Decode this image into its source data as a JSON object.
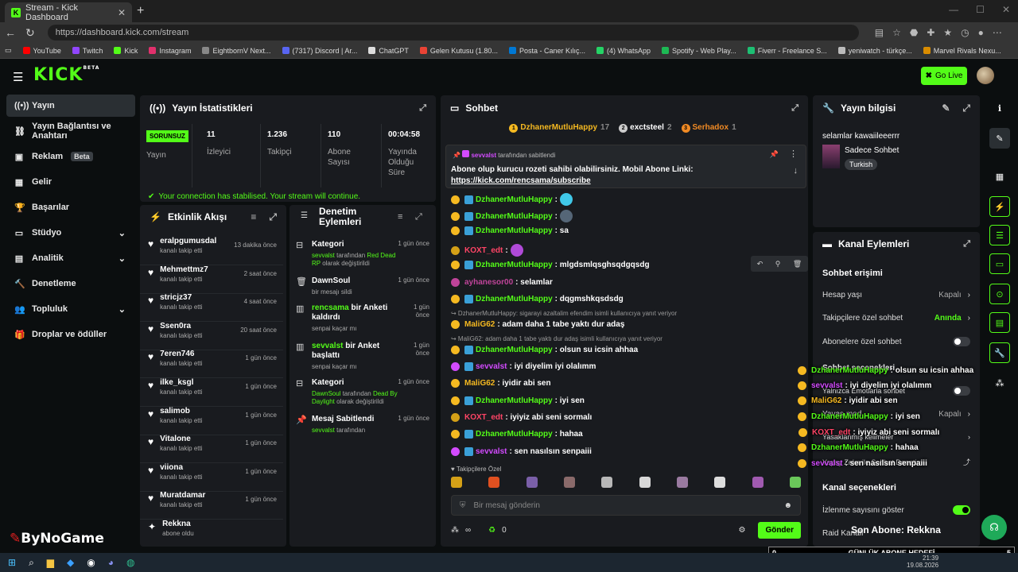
{
  "browser": {
    "tab_title": "Stream - Kick Dashboard",
    "url": "https://dashboard.kick.com/stream",
    "bookmarks": [
      {
        "label": "YouTube",
        "color": "#ff0000"
      },
      {
        "label": "Twitch",
        "color": "#9146ff"
      },
      {
        "label": "Kick",
        "color": "#53fc18"
      },
      {
        "label": "Instagram",
        "color": "#e1306c"
      },
      {
        "label": "EightbornV Next...",
        "color": "#888888"
      },
      {
        "label": "(7317) Discord | Ar...",
        "color": "#5865f2"
      },
      {
        "label": "ChatGPT",
        "color": "#dddddd"
      },
      {
        "label": "Gelen Kutusu (1.80...",
        "color": "#ea4335"
      },
      {
        "label": "Posta - Caner Kılıç...",
        "color": "#0078d4"
      },
      {
        "label": "(4) WhatsApp",
        "color": "#25d366"
      },
      {
        "label": "Spotify - Web Play...",
        "color": "#1db954"
      },
      {
        "label": "Fiverr - Freelance S...",
        "color": "#1dbf73"
      },
      {
        "label": "yeniwatch - türkçe...",
        "color": "#bbbbbb"
      },
      {
        "label": "Marvel Rivals Nexu...",
        "color": "#d98c00"
      }
    ]
  },
  "header": {
    "logo": "KICK",
    "logo_sup": "BETA",
    "go_live": "Go Live"
  },
  "sidebar": {
    "items": [
      {
        "label": "Yayın",
        "icon": "broadcast-icon",
        "active": true
      },
      {
        "label": "Yayın Bağlantısı ve Anahtarı",
        "icon": "link-icon"
      },
      {
        "label": "Reklam",
        "icon": "ad-icon",
        "badge": "Beta"
      },
      {
        "label": "Gelir",
        "icon": "revenue-icon"
      },
      {
        "label": "Başarılar",
        "icon": "trophy-icon"
      },
      {
        "label": "Stüdyo",
        "icon": "studio-icon",
        "chevron": true
      },
      {
        "label": "Analitik",
        "icon": "chart-icon",
        "chevron": true
      },
      {
        "label": "Denetleme",
        "icon": "hammer-icon"
      },
      {
        "label": "Topluluk",
        "icon": "community-icon",
        "chevron": true
      },
      {
        "label": "Droplar ve ödüller",
        "icon": "gift-icon"
      }
    ],
    "watermark": "ByNoGame"
  },
  "stats": {
    "title": "Yayın İstatistikleri",
    "status_badge": "SORUNSUZ",
    "status_label": "Yayın",
    "cells": [
      {
        "value": "11",
        "label": "İzleyici"
      },
      {
        "value": "1.236",
        "label": "Takipçi"
      },
      {
        "value": "110",
        "label": "Abone Sayısı"
      },
      {
        "value": "00:04:58",
        "label": "Yayında Olduğu Süre"
      }
    ],
    "connection": "Your connection has stabilised. Your stream will continue."
  },
  "activity": {
    "title": "Etkinlik Akışı",
    "rows": [
      {
        "name": "eralpgumusdal",
        "sub": "kanalı takip etti",
        "time": "13 dakika önce"
      },
      {
        "name": "Mehmettmz7",
        "sub": "kanalı takip etti",
        "time": "2 saat önce"
      },
      {
        "name": "stricjz37",
        "sub": "kanalı takip etti",
        "time": "4 saat önce"
      },
      {
        "name": "Ssen0ra",
        "sub": "kanalı takip etti",
        "time": "20 saat önce"
      },
      {
        "name": "7eren746",
        "sub": "kanalı takip etti",
        "time": "1 gün önce"
      },
      {
        "name": "ilke_ksgl",
        "sub": "kanalı takip etti",
        "time": "1 gün önce"
      },
      {
        "name": "salimob",
        "sub": "kanalı takip etti",
        "time": "1 gün önce"
      },
      {
        "name": "Vitalone",
        "sub": "kanalı takip etti",
        "time": "1 gün önce"
      },
      {
        "name": "viiona",
        "sub": "kanalı takip etti",
        "time": "1 gün önce"
      },
      {
        "name": "Muratdamar",
        "sub": "kanalı takip etti",
        "time": "1 gün önce"
      },
      {
        "name": "Rekkna",
        "sub": "abone oldu",
        "time": ""
      }
    ]
  },
  "moderation": {
    "title1": "Denetim",
    "title2": "Eylemleri",
    "rows": [
      {
        "title": "Kategori",
        "time": "1 gün önce",
        "sub_a": "sevvalst",
        "sub_b": " tarafından ",
        "sub_c": "Red Dead RP",
        "sub_d": " olarak değiştirildi"
      },
      {
        "title": "DawnSoul",
        "time": "1 gün önce",
        "sub": "bir mesajı sildi"
      },
      {
        "title_a": "rencsama",
        "title_b": " bir Anketi kaldırdı",
        "time1": "1 gün",
        "time2": "önce",
        "sub": "senpai kaçar mı"
      },
      {
        "title_a": "sevvalst",
        "title_b": " bir Anket başlattı",
        "time1": "1 gün",
        "time2": "önce",
        "sub": "senpai kaçar mı"
      },
      {
        "title": "Kategori",
        "time": "1 gün önce",
        "sub_a": "DawnSoul",
        "sub_b": " tarafından ",
        "sub_c": "Dead By Daylight",
        "sub_d": " olarak değiştirildi"
      },
      {
        "title": "Mesaj Sabitlendi",
        "time": "1 gün önce",
        "sub_a": "sevvalst",
        "sub_b": " tarafından"
      }
    ]
  },
  "chat": {
    "title": "Sohbet",
    "top": [
      {
        "name": "DzhanerMutluHappy",
        "count": "17"
      },
      {
        "name": "exctsteel",
        "count": "2"
      },
      {
        "name": "Serhadox",
        "count": "1"
      }
    ],
    "pinned_by": "sevvalst",
    "pinned_suffix": "tarafından sabitlendi",
    "pinned_text": "Abone olup kurucu rozeti sahibi olabilirsiniz. Mobil Abone Linki:",
    "pinned_link": "https://kick.com/rencsama/subscribe",
    "messages": [
      {
        "user": "DzhanerMutluHappy",
        "color": "#53fc18",
        "text": ":",
        "emote": "#40c8e8"
      },
      {
        "user": "DzhanerMutluHappy",
        "color": "#53fc18",
        "text": ":",
        "emote": "#556677"
      },
      {
        "user": "DzhanerMutluHappy",
        "color": "#53fc18",
        "text": ": sa"
      },
      {
        "user": "KOXT_edt",
        "color": "#ff4466",
        "text": ":",
        "emote": "#b04ad8"
      },
      {
        "user": "DzhanerMutluHappy",
        "color": "#53fc18",
        "text": ": mlgdsmlqsghsqdgqsdg"
      },
      {
        "user": "ayhanesor00",
        "color": "#c0449a",
        "text": ": selamlar"
      },
      {
        "user": "DzhanerMutluHappy",
        "color": "#53fc18",
        "text": ": dqgmshkqsdsdg"
      },
      {
        "user": "MaliG62",
        "color": "#f5b921",
        "text": ": adam daha 1 tabe yaktı dur adaş"
      },
      {
        "user": "DzhanerMutluHappy",
        "color": "#53fc18",
        "text": ": olsun su icsin ahhaa"
      },
      {
        "user": "sevvalst",
        "color": "#d34bff",
        "text": ": iyi diyelim iyi olalımm"
      },
      {
        "user": "MaliG62",
        "color": "#f5b921",
        "text": ": iyidir abi sen"
      },
      {
        "user": "DzhanerMutluHappy",
        "color": "#53fc18",
        "text": ": iyi sen"
      },
      {
        "user": "KOXT_edt",
        "color": "#ff4466",
        "text": ": iyiyiz abi seni sormalı"
      },
      {
        "user": "DzhanerMutluHappy",
        "color": "#53fc18",
        "text": ": hahaa"
      },
      {
        "user": "sevvalst",
        "color": "#d34bff",
        "text": ": sen nasılsın senpaiii"
      }
    ],
    "reply1": "↪ DzhanerMutluHappy: sigarayi azaltalim efendim isimli kullanıcıya yanıt veriyor",
    "reply2": "↪ MaliG62: adam daha 1 tabe yaktı dur adaş isimli kullanıcıya yanıt veriyor",
    "followers_only_label": "Takipçilere Özel",
    "input_placeholder": "Bir mesaj gönderin",
    "infinity": "∞",
    "points": "0",
    "send": "Gönder"
  },
  "stream_info": {
    "title": "Yayın bilgisi",
    "stream_title": "selamlar kawaiileeerrr",
    "category": "Sadece Sohbet",
    "tag": "Turkish"
  },
  "channel_actions": {
    "title": "Kanal Eylemleri",
    "chat_access": "Sohbet erişimi",
    "rows": [
      {
        "label": "Hesap yaşı",
        "value": "Kapalı"
      },
      {
        "label": "Takipçilere özel sohbet",
        "value": "Anında"
      },
      {
        "label": "Abonelere özel sohbet",
        "toggle": false
      },
      {
        "label": "Sohbet seçenekleri"
      },
      {
        "label": "Yalnızca Emotlarla sohbet",
        "toggle": false
      },
      {
        "label": "Yavaş mod",
        "value": "Kapalı"
      },
      {
        "label": "Yasaklanmış kelimeler"
      },
      {
        "label": "Yapay Zeka ile Sohbet Denetimi"
      }
    ],
    "channel_options": "Kanal seçenekleri",
    "show_views": "İzlenme sayısını göster",
    "raid": "Raid Kanalı"
  },
  "overlay": {
    "chat": [
      {
        "user": "DzhanerMutluHappy",
        "text": ": olsun su icsin ahhaa",
        "color": "#53fc18"
      },
      {
        "user": "sevvalst",
        "text": ": iyi diyelim iyi olalımm",
        "color": "#d34bff"
      },
      {
        "user": "MaliG62",
        "text": ": iyidir abi sen",
        "color": "#f5b921"
      },
      {
        "user": "DzhanerMutluHappy",
        "text": ": iyi sen",
        "color": "#53fc18"
      },
      {
        "user": "KOXT_edt",
        "text": ": iyiyiz abi seni sormalı",
        "color": "#ff4466"
      },
      {
        "user": "DzhanerMutluHappy",
        "text": ": hahaa",
        "color": "#53fc18"
      },
      {
        "user": "sevvalst",
        "text": ": sen nasılsın senpaiii",
        "color": "#d34bff"
      }
    ],
    "last_sub": "Son Abone: Rekkna",
    "goal_left": "0",
    "goal_label": "GÜNLÜK ABONE HEDEFİ",
    "goal_right": "5"
  },
  "taskbar": {
    "time": "21:39",
    "date": "19.08.2026"
  }
}
